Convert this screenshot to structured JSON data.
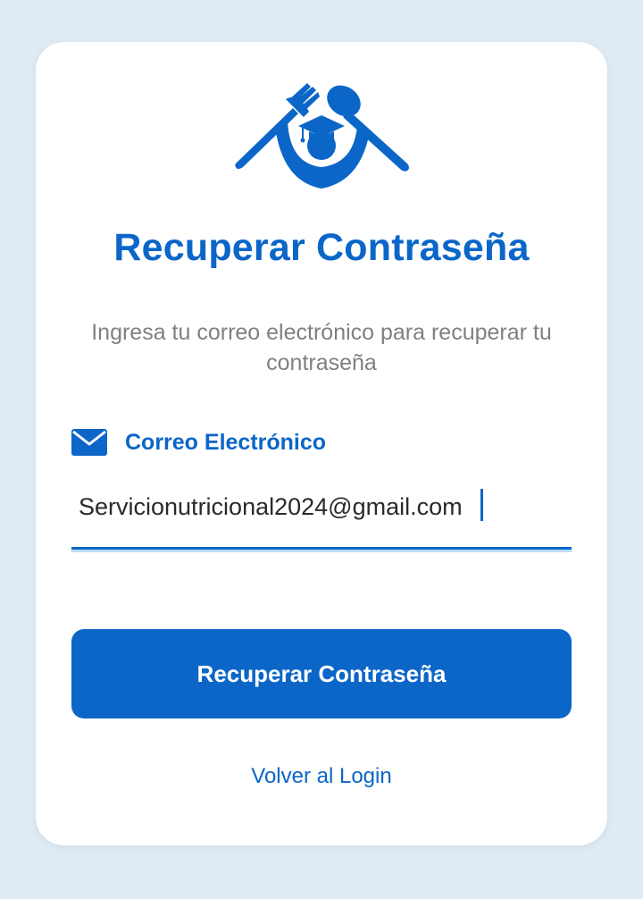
{
  "card": {
    "logo_icon": "fork-spoon-graduate-icon",
    "title": "Recuperar Contraseña",
    "subtitle": "Ingresa tu correo electrónico para recuperar tu contraseña"
  },
  "email_field": {
    "icon": "envelope-icon",
    "label": "Correo Electrónico",
    "value": "Servicionutricional2024@gmail.com"
  },
  "actions": {
    "submit_label": "Recuperar Contraseña",
    "back_label": "Volver al Login"
  },
  "colors": {
    "background": "#dfeaf3",
    "card": "#ffffff",
    "accent": "#0b66c8",
    "muted_text": "#808080",
    "input_text": "#2a2a2a"
  }
}
